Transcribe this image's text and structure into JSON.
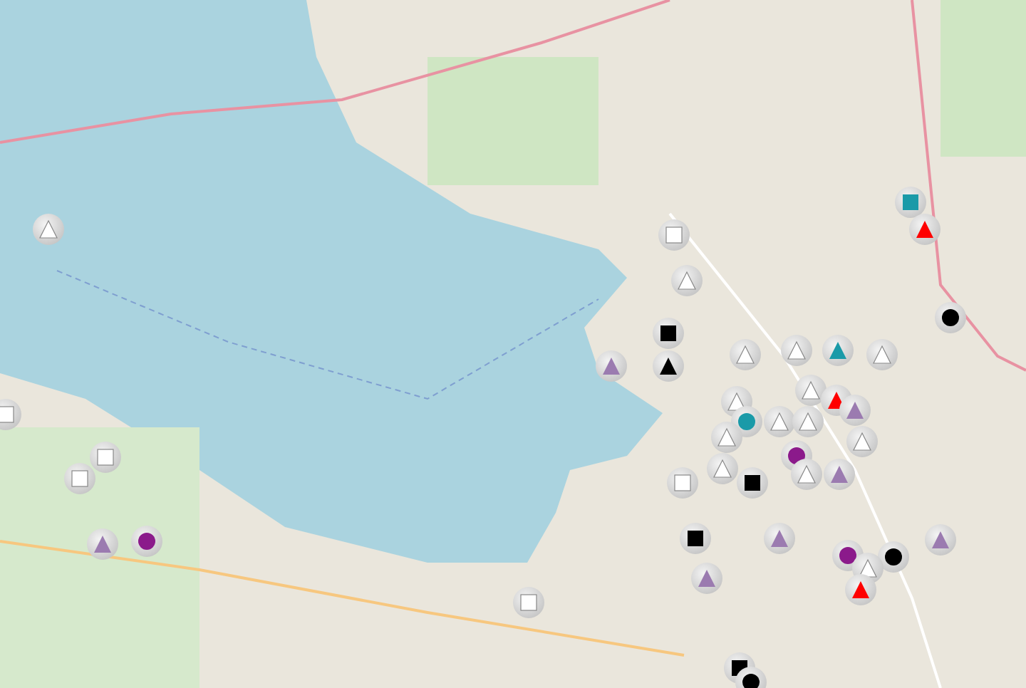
{
  "map": {
    "markers": [
      {
        "kind": "triangle",
        "color": "#ffffff"
      },
      {
        "kind": "square",
        "color": "#ffffff"
      },
      {
        "kind": "square",
        "color": "#ffffff"
      },
      {
        "kind": "square",
        "color": "#ffffff"
      },
      {
        "kind": "triangle",
        "color": "#9b7bb0"
      },
      {
        "kind": "circle",
        "color": "#8b1a8b"
      },
      {
        "kind": "square",
        "color": "#ffffff"
      },
      {
        "kind": "triangle",
        "color": "#9b7bb0"
      },
      {
        "kind": "square",
        "color": "#ffffff"
      },
      {
        "kind": "triangle",
        "color": "#ffffff"
      },
      {
        "kind": "square",
        "color": "#000000"
      },
      {
        "kind": "triangle",
        "color": "#000000"
      },
      {
        "kind": "triangle",
        "color": "#ffffff"
      },
      {
        "kind": "triangle",
        "color": "#ffffff"
      },
      {
        "kind": "triangle",
        "color": "#1a9aa8"
      },
      {
        "kind": "triangle",
        "color": "#ffffff"
      },
      {
        "kind": "square",
        "color": "#1a9aa8"
      },
      {
        "kind": "triangle",
        "color": "#ff0000"
      },
      {
        "kind": "circle",
        "color": "#000000"
      },
      {
        "kind": "triangle",
        "color": "#ffffff"
      },
      {
        "kind": "triangle",
        "color": "#ff0000"
      },
      {
        "kind": "triangle",
        "color": "#9b7bb0"
      },
      {
        "kind": "triangle",
        "color": "#ffffff"
      },
      {
        "kind": "circle",
        "color": "#1a9aa8"
      },
      {
        "kind": "triangle",
        "color": "#ffffff"
      },
      {
        "kind": "triangle",
        "color": "#ffffff"
      },
      {
        "kind": "triangle",
        "color": "#ffffff"
      },
      {
        "kind": "triangle",
        "color": "#ffffff"
      },
      {
        "kind": "circle",
        "color": "#8b1a8b"
      },
      {
        "kind": "triangle",
        "color": "#ffffff"
      },
      {
        "kind": "triangle",
        "color": "#ffffff"
      },
      {
        "kind": "triangle",
        "color": "#9b7bb0"
      },
      {
        "kind": "square",
        "color": "#ffffff"
      },
      {
        "kind": "square",
        "color": "#000000"
      },
      {
        "kind": "square",
        "color": "#000000"
      },
      {
        "kind": "triangle",
        "color": "#9b7bb0"
      },
      {
        "kind": "triangle",
        "color": "#9b7bb0"
      },
      {
        "kind": "circle",
        "color": "#8b1a8b"
      },
      {
        "kind": "circle",
        "color": "#000000"
      },
      {
        "kind": "triangle",
        "color": "#ffffff"
      },
      {
        "kind": "triangle",
        "color": "#ff0000"
      },
      {
        "kind": "triangle",
        "color": "#9b7bb0"
      },
      {
        "kind": "square",
        "color": "#000000"
      },
      {
        "kind": "circle",
        "color": "#000000"
      }
    ]
  }
}
